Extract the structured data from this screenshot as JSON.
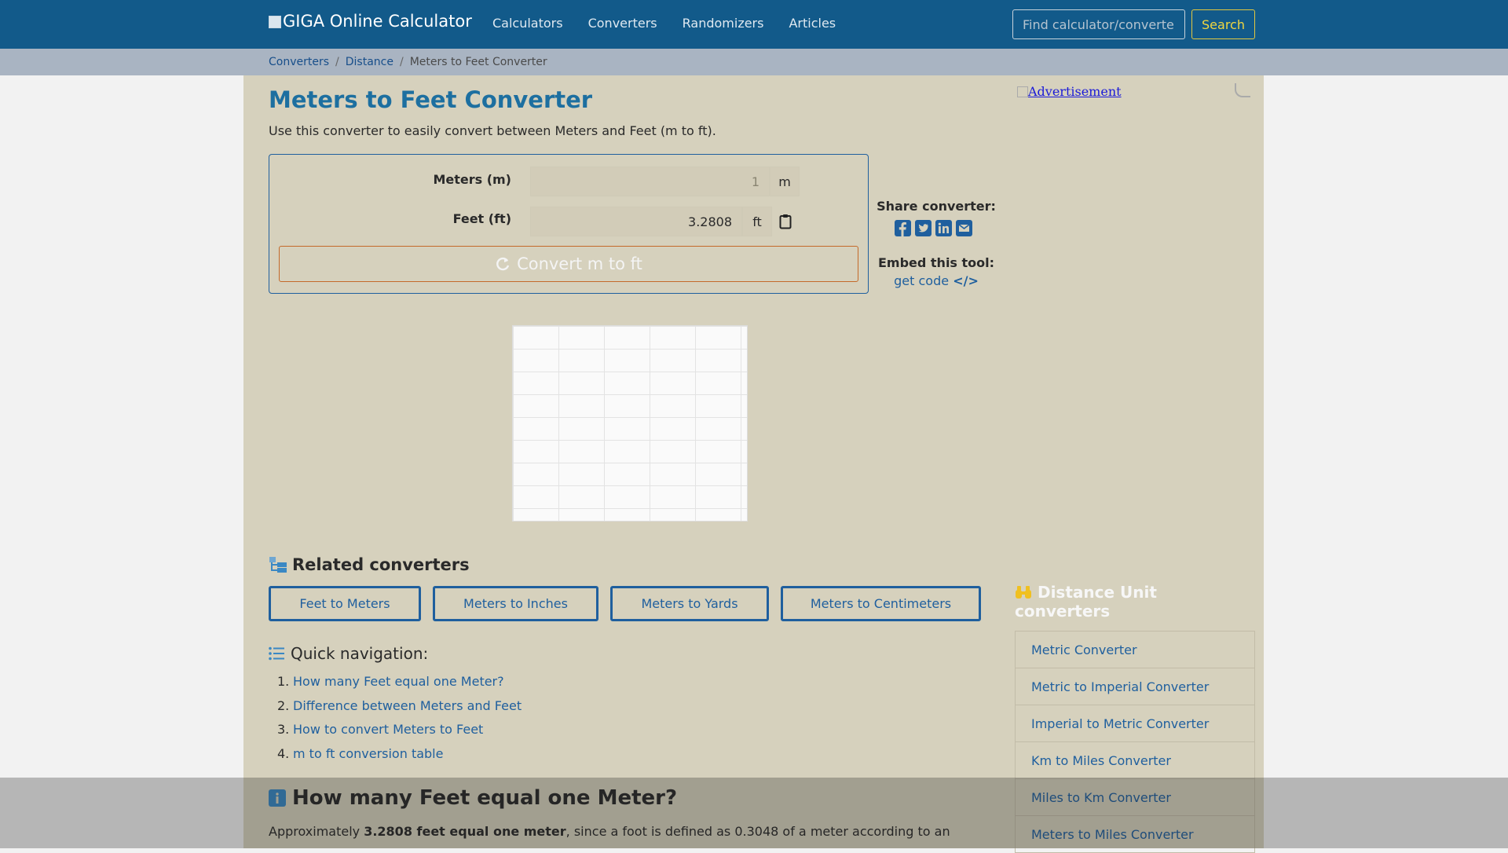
{
  "navbar": {
    "brand": "GIGA Online Calculator",
    "links": [
      "Calculators",
      "Converters",
      "Randomizers",
      "Articles"
    ],
    "search_placeholder": "Find calculator/converter",
    "search_button": "Search"
  },
  "breadcrumb": {
    "items": [
      "Converters",
      "Distance"
    ],
    "current": "Meters to Feet Converter"
  },
  "page": {
    "title": "Meters to Feet Converter",
    "intro": "Use this converter to easily convert between Meters and Feet (m to ft)."
  },
  "converter": {
    "meters_label": "Meters (m)",
    "meters_value": "1",
    "meters_unit": "m",
    "feet_label": "Feet (ft)",
    "feet_value": "3.2808",
    "feet_unit": "ft",
    "convert_button": "Convert m to ft"
  },
  "share": {
    "label": "Share converter:",
    "icons": [
      "facebook-icon",
      "twitter-icon",
      "linkedin-icon",
      "email-icon"
    ],
    "embed_label": "Embed this tool:",
    "embed_link": "get code"
  },
  "ads": {
    "right_alt": "Advertisement"
  },
  "related": {
    "heading": "Related converters",
    "buttons": [
      "Feet to Meters",
      "Meters to Inches",
      "Meters to Yards",
      "Meters to Centimeters"
    ]
  },
  "quick_nav": {
    "heading": "Quick navigation:",
    "items": [
      "How many Feet equal one Meter?",
      "Difference between Meters and Feet",
      "How to convert Meters to Feet",
      "m to ft conversion table"
    ]
  },
  "section_how": {
    "heading": "How many Feet equal one Meter?",
    "text_before": "Approximately ",
    "text_bold": "3.2808 feet equal one meter",
    "text_after": ", since a foot is defined as 0.3048 of a meter according to an"
  },
  "sidebar": {
    "heading": "Distance Unit converters",
    "items": [
      "Metric Converter",
      "Metric to Imperial Converter",
      "Imperial to Metric Converter",
      "Km to Miles Converter",
      "Miles to Km Converter",
      "Meters to Miles Converter"
    ]
  },
  "colors": {
    "navbar": "#125a8a",
    "panel": "#d6d1bd",
    "accent": "#1f5f9e",
    "search_button": "#f0d640",
    "convert_border": "#c46a2a"
  }
}
